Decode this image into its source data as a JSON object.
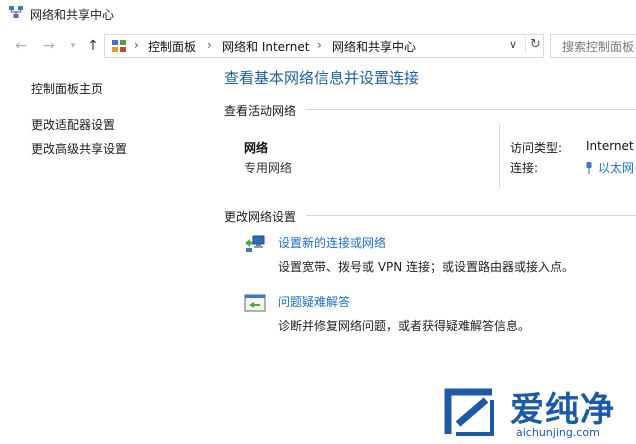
{
  "window": {
    "title": "网络和共享中心"
  },
  "address_bar": {
    "crumbs": [
      "控制面板",
      "网络和 Internet",
      "网络和共享中心"
    ],
    "search_placeholder": "搜索控制面板"
  },
  "sidebar": {
    "items": [
      {
        "label": "控制面板主页"
      },
      {
        "label": "更改适配器设置"
      },
      {
        "label": "更改高级共享设置"
      }
    ]
  },
  "main": {
    "title": "查看基本网络信息并设置连接",
    "active_networks": {
      "heading": "查看活动网络",
      "network_name": "网络",
      "network_type": "专用网络",
      "access_type_label": "访问类型:",
      "access_type_value": "Internet",
      "connections_label": "连接:",
      "connections_value": "以太网"
    },
    "change_settings": {
      "heading": "更改网络设置",
      "tasks": [
        {
          "label": "设置新的连接或网络",
          "description": "设置宽带、拨号或 VPN 连接；或设置路由器或接入点。",
          "icon": "network-setup-icon"
        },
        {
          "label": "问题疑难解答",
          "description": "诊断并修复网络问题，或者获得疑难解答信息。",
          "icon": "troubleshoot-icon"
        }
      ]
    }
  },
  "watermark": {
    "brand": "爱纯净",
    "url": "aichunjing.com"
  },
  "colors": {
    "link": "#1f6fc5",
    "title": "#1f5e9f",
    "brand": "#1c5aa8"
  }
}
